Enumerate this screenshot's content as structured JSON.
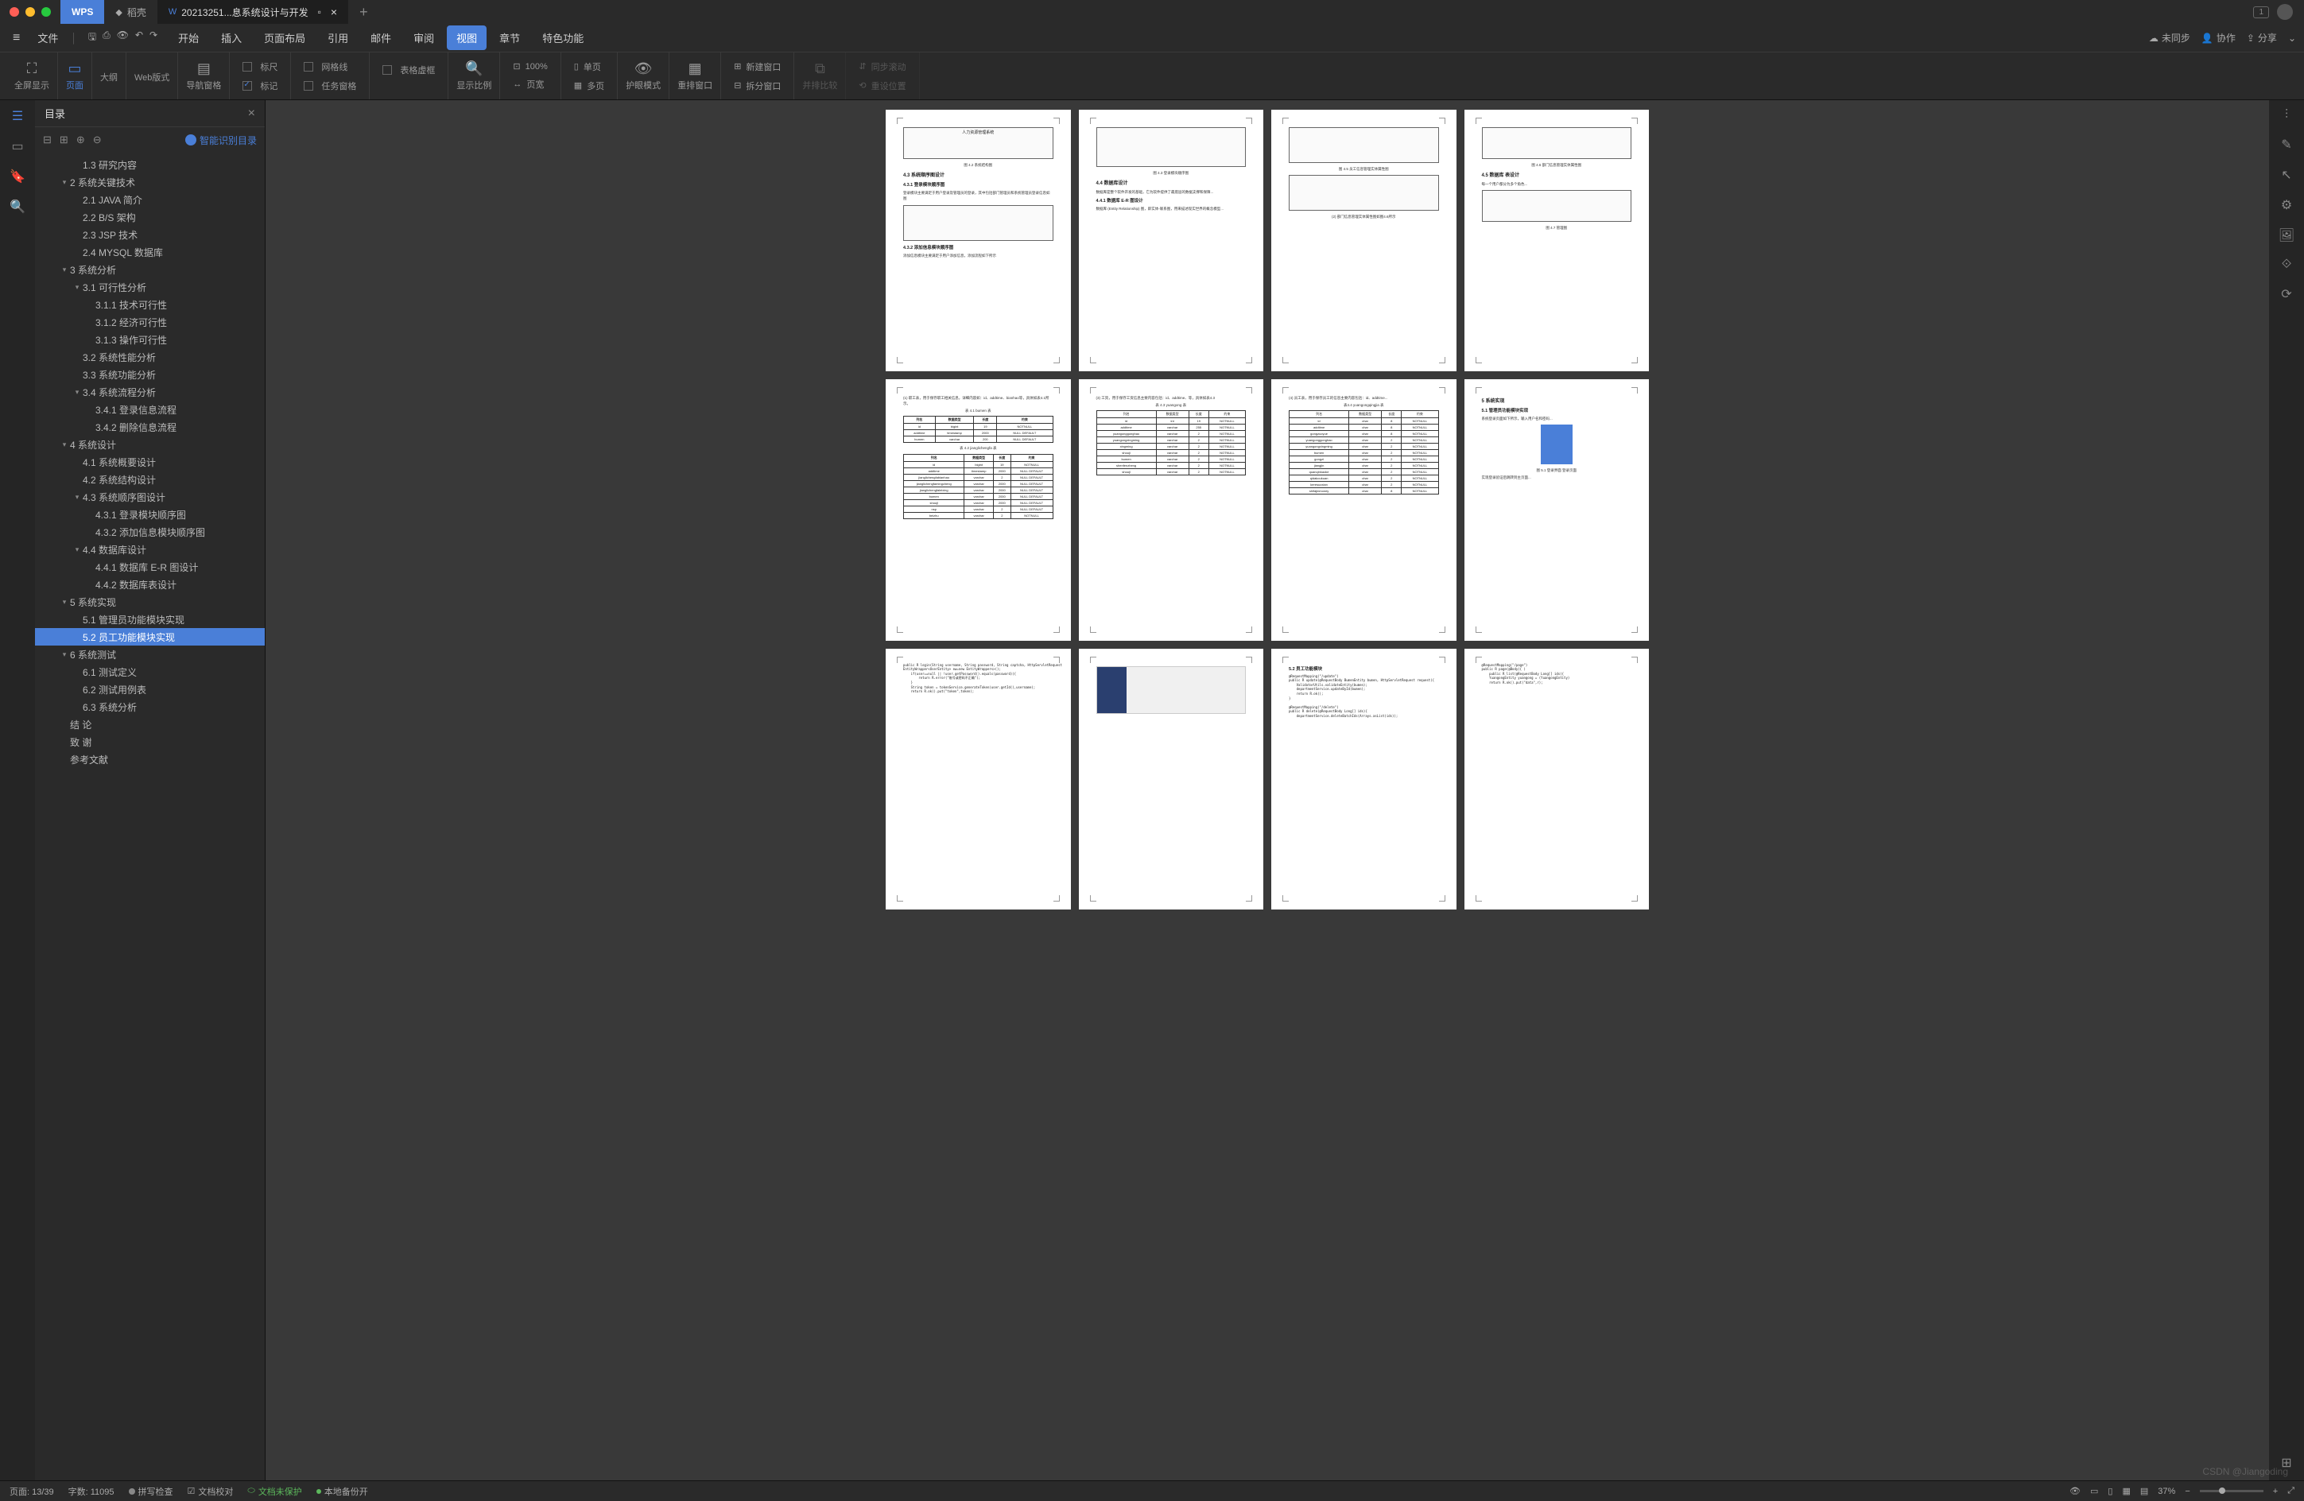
{
  "titlebar": {
    "wps_label": "WPS",
    "tab1_label": "稻壳",
    "tab2_label": "20213251...息系统设计与开发",
    "window_count": "1"
  },
  "menubar": {
    "file": "文件",
    "items": [
      "开始",
      "插入",
      "页面布局",
      "引用",
      "邮件",
      "审阅",
      "视图",
      "章节",
      "特色功能"
    ],
    "active_index": 6,
    "right": {
      "unsync": "未同步",
      "collab": "协作",
      "share": "分享"
    }
  },
  "ribbon": {
    "fullscreen": "全屏显示",
    "page": "页面",
    "outline": "大纲",
    "web": "Web版式",
    "navpane": "导航窗格",
    "ruler": "标尺",
    "gridlines": "网格线",
    "virtualframe": "表格虚框",
    "markup": "标记",
    "taskpane": "任务窗格",
    "zoom": "显示比例",
    "zoom100": "100%",
    "pagewidth": "页宽",
    "onepage": "单页",
    "multipage": "多页",
    "eyecare": "护眼模式",
    "rearrange": "重排窗口",
    "newwindow": "新建窗口",
    "splitwindow": "拆分窗口",
    "sidebyside": "并排比较",
    "syncscroll": "同步滚动",
    "resetpos": "重设位置"
  },
  "sidebar": {
    "title": "目录",
    "ai_label": "智能识别目录",
    "items": [
      {
        "level": 2,
        "text": "1.3 研究内容",
        "caret": ""
      },
      {
        "level": 1,
        "text": "2 系统关键技术",
        "caret": "▾"
      },
      {
        "level": 2,
        "text": "2.1 JAVA 简介",
        "caret": ""
      },
      {
        "level": 2,
        "text": "2.2 B/S 架构",
        "caret": ""
      },
      {
        "level": 2,
        "text": "2.3 JSP 技术",
        "caret": ""
      },
      {
        "level": 2,
        "text": "2.4 MYSQL 数据库",
        "caret": ""
      },
      {
        "level": 1,
        "text": "3 系统分析",
        "caret": "▾"
      },
      {
        "level": 2,
        "text": "3.1 可行性分析",
        "caret": "▾"
      },
      {
        "level": 3,
        "text": "3.1.1 技术可行性",
        "caret": ""
      },
      {
        "level": 3,
        "text": "3.1.2 经济可行性",
        "caret": ""
      },
      {
        "level": 3,
        "text": "3.1.3 操作可行性",
        "caret": ""
      },
      {
        "level": 2,
        "text": "3.2 系统性能分析",
        "caret": ""
      },
      {
        "level": 2,
        "text": "3.3 系统功能分析",
        "caret": ""
      },
      {
        "level": 2,
        "text": "3.4 系统流程分析",
        "caret": "▾"
      },
      {
        "level": 3,
        "text": "3.4.1 登录信息流程",
        "caret": ""
      },
      {
        "level": 3,
        "text": "3.4.2 删除信息流程",
        "caret": ""
      },
      {
        "level": 1,
        "text": "4 系统设计",
        "caret": "▾"
      },
      {
        "level": 2,
        "text": "4.1 系统概要设计",
        "caret": ""
      },
      {
        "level": 2,
        "text": "4.2 系统结构设计",
        "caret": ""
      },
      {
        "level": 2,
        "text": "4.3 系统顺序图设计",
        "caret": "▾"
      },
      {
        "level": 3,
        "text": "4.3.1 登录模块顺序图",
        "caret": ""
      },
      {
        "level": 3,
        "text": "4.3.2 添加信息模块顺序图",
        "caret": ""
      },
      {
        "level": 2,
        "text": "4.4 数据库设计",
        "caret": "▾"
      },
      {
        "level": 3,
        "text": "4.4.1 数据库 E-R 图设计",
        "caret": ""
      },
      {
        "level": 3,
        "text": "4.4.2 数据库表设计",
        "caret": ""
      },
      {
        "level": 1,
        "text": "5 系统实现",
        "caret": "▾"
      },
      {
        "level": 2,
        "text": "5.1 管理员功能模块实现",
        "caret": ""
      },
      {
        "level": 2,
        "text": "5.2 员工功能模块实现",
        "caret": "",
        "active": true
      },
      {
        "level": 1,
        "text": "6 系统测试",
        "caret": "▾"
      },
      {
        "level": 2,
        "text": "6.1 测试定义",
        "caret": ""
      },
      {
        "level": 2,
        "text": "6.2 测试用例表",
        "caret": ""
      },
      {
        "level": 2,
        "text": "6.3 系统分析",
        "caret": ""
      },
      {
        "level": 1,
        "text": "结  论",
        "caret": ""
      },
      {
        "level": 1,
        "text": "致  谢",
        "caret": ""
      },
      {
        "level": 1,
        "text": "参考文献",
        "caret": ""
      }
    ]
  },
  "pages": {
    "p1": {
      "h1": "4.3 系统顺序图设计",
      "h2": "4.3.1 登录模块顺序图",
      "cap1": "图 4.2 系统结构图",
      "h3": "4.3.2 添加信息模块顺序图",
      "diag_title": "人力资源管理系统"
    },
    "p2": {
      "h1": "4.4 数据库设计",
      "h2": "4.4.1 数据库 E-R 图设计",
      "cap1": "图 4.3 登录模块顺序图"
    },
    "p3": {
      "cap1": "图 4.5 员工信息管理实体属性图",
      "cap2": "(2) 部门信息管理实体属性图如图4.6所示"
    },
    "p4": {
      "h1": "4.5 数据库 表设计",
      "cap1": "图 4.6 部门信息管理实体属性图",
      "cap2": "图 4.7 管理图"
    },
    "p5": {
      "intro": "(1) 职工表，用于保存职工相关信息，详细内容如：id、addtime、bianhao等，具体如表4.1所示。",
      "tab1_cap": "表 4.1 bumen 表",
      "headers": [
        "列名",
        "数据类型",
        "长度",
        "约束"
      ],
      "rows1": [
        [
          "id",
          "bigint",
          "19",
          "NOTNULL"
        ],
        [
          "addtime",
          "timestamp",
          "2000",
          "NULL DEFAULT"
        ],
        [
          "bumen",
          "varchar",
          "200",
          "NULL DEFAULT"
        ]
      ],
      "tab2_cap": "表 4.2 jianglichengfa 表",
      "rows2": [
        [
          "id",
          "bigint",
          "19",
          "NOTNULL"
        ],
        [
          "addtime",
          "timestamp",
          "2000",
          "NULL DEFAULT"
        ],
        [
          "jianglichengfabianhao",
          "varchar",
          "2",
          "NULL DEFAULT"
        ],
        [
          "jianglichengfamingcheng",
          "varchar",
          "2000",
          "NULL DEFAULT"
        ],
        [
          "jianglichengfaleixing",
          "varchar",
          "2000",
          "NULL DEFAULT"
        ],
        [
          "bumen",
          "varchar",
          "2000",
          "NULL DEFAULT"
        ],
        [
          "shoujl",
          "varchar",
          "2000",
          "NULL DEFAULT"
        ],
        [
          "nsp",
          "varchar",
          "2",
          "NULL DEFAULT"
        ],
        [
          "beizhu",
          "varchar",
          "2",
          "NOTNULL"
        ]
      ]
    },
    "p6": {
      "intro": "(3) 工资，用于保存工资信息主要内容包括：id、addtime、等，具体如表4.3",
      "tab_cap": "表 4.3 yuangong 表",
      "rows": [
        [
          "列名",
          "数据类型",
          "长度",
          "约束"
        ],
        [
          "id",
          "int",
          "19",
          "NOTNULL"
        ],
        [
          "addtime",
          "varchar",
          "255",
          "NOTNULL"
        ],
        [
          "yuangonggonghao",
          "varchar",
          "2",
          "NOTNULL"
        ],
        [
          "yuangongxingming",
          "varchar",
          "2",
          "NOTNULL"
        ],
        [
          "xingming",
          "varchar",
          "2",
          "NOTNULL"
        ],
        [
          "shouji",
          "varchar",
          "2",
          "NOTNULL"
        ],
        [
          "bumen",
          "varchar",
          "2",
          "NOTNULL"
        ],
        [
          "shenfenzheng",
          "varchar",
          "2",
          "NOTNULL"
        ],
        [
          "shoujl",
          "varchar",
          "2",
          "NOTNULL"
        ]
      ]
    },
    "p7": {
      "intro": "(4) 员工表，用于保存员工的信息主要内容包括：id、addtime...",
      "tab_cap": "表4.4 yuangongqingjia 表",
      "rows": [
        [
          "列名",
          "数据类型",
          "长度",
          "约束"
        ],
        [
          "id",
          "char",
          "8",
          "NOTNULL"
        ],
        [
          "addtime",
          "char",
          "8",
          "NOTNULL"
        ],
        [
          "gongzuoyue",
          "char",
          "8",
          "NOTNULL"
        ],
        [
          "yuangonggonghao",
          "char",
          "2",
          "NOTNULL"
        ],
        [
          "yuangongxingming",
          "char",
          "2",
          "NOTNULL"
        ],
        [
          "bumen",
          "char",
          "2",
          "NOTNULL"
        ],
        [
          "gongzi",
          "char",
          "2",
          "NOTNULL"
        ],
        [
          "jiangjin",
          "char",
          "2",
          "NOTNULL"
        ],
        [
          "quanqinkaoke",
          "char",
          "2",
          "NOTNULL"
        ],
        [
          "qidakoukuan",
          "char",
          "2",
          "NOTNULL"
        ],
        [
          "keresuoxian",
          "char",
          "2",
          "NOTNULL"
        ],
        [
          "shifajinmoney",
          "char",
          "8",
          "NOTNULL"
        ]
      ]
    },
    "p8": {
      "h1": "5 系统实现",
      "h2": "5.1 管理员功能模块实现",
      "cap": "图 5.1 登录界面 登录页面"
    },
    "p9": {
      "code": "public R login(String username, String password, String captcha, HttpServletRequest\nEntityWrapper<UserEntity> ew=new EntityWrapper<>();\n    if(user==null || !user.getPassword().equals(password)){\n        return R.error(\"账号或密码不正确\");\n    }\n    String token = tokenService.generateToken(user.getId(),username);\n    return R.ok().put(\"token\",token);"
    },
    "p11": {
      "h1": "5.2 员工功能模块",
      "code": "@RequestMapping(\"/update\")\npublic R update(@RequestBody BumenEntity bumen, HttpServletRequest request){\n    ValidatorUtils.validateEntity(bumen);\n    departmentService.updateById(bumen);\n    return R.ok();\n}\n\n@RequestMapping(\"/delete\")\npublic R delete(@RequestBody Long[] ids){\n    departmentService.deleteBatchIds(Arrays.asList(ids));"
    },
    "p12": {
      "code": "@RequestMapping(\"/page\")\npublic R page(@Body){ )\n    public R list(@RequestBody Long[] ids){\n    YuangongEntity yuangong = (YuangongEntity)\n    return R.ok().put(\"data\",r);"
    }
  },
  "statusbar": {
    "page": "页面: 13/39",
    "words": "字数: 11095",
    "spellcheck": "拼写检查",
    "proofread": "文档校对",
    "unprotected": "文档未保护",
    "localbackup": "本地备份开",
    "zoom": "37%"
  },
  "watermark": "CSDN @Jiangoding"
}
